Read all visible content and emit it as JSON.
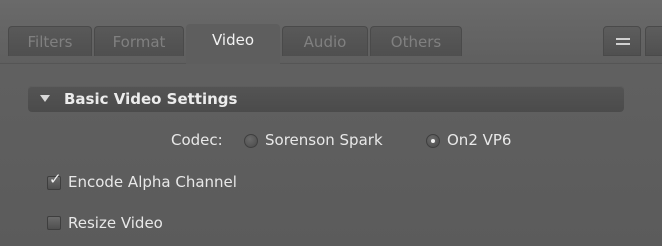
{
  "tabs": [
    {
      "label": "Filters",
      "active": false
    },
    {
      "label": "Format",
      "active": false
    },
    {
      "label": "Video",
      "active": true
    },
    {
      "label": "Audio",
      "active": false
    },
    {
      "label": "Others",
      "active": false
    }
  ],
  "panel_menu_icon": "panel-menu-icon",
  "section": {
    "title": "Basic Video Settings",
    "expanded": true,
    "disclosure_icon": "triangle-down-icon"
  },
  "codec": {
    "label": "Codec:",
    "options": [
      {
        "label": "Sorenson Spark",
        "selected": false
      },
      {
        "label": "On2 VP6",
        "selected": true
      }
    ]
  },
  "encode_alpha": {
    "label": "Encode Alpha Channel",
    "checked": true
  },
  "resize_video": {
    "label": "Resize Video",
    "checked": false
  },
  "colors": {
    "panel_bg": "#5e5e5e",
    "section_header_bg": "#4f4f4f",
    "inactive_tab_text": "#808080",
    "active_tab_text": "#f2f2f2"
  }
}
